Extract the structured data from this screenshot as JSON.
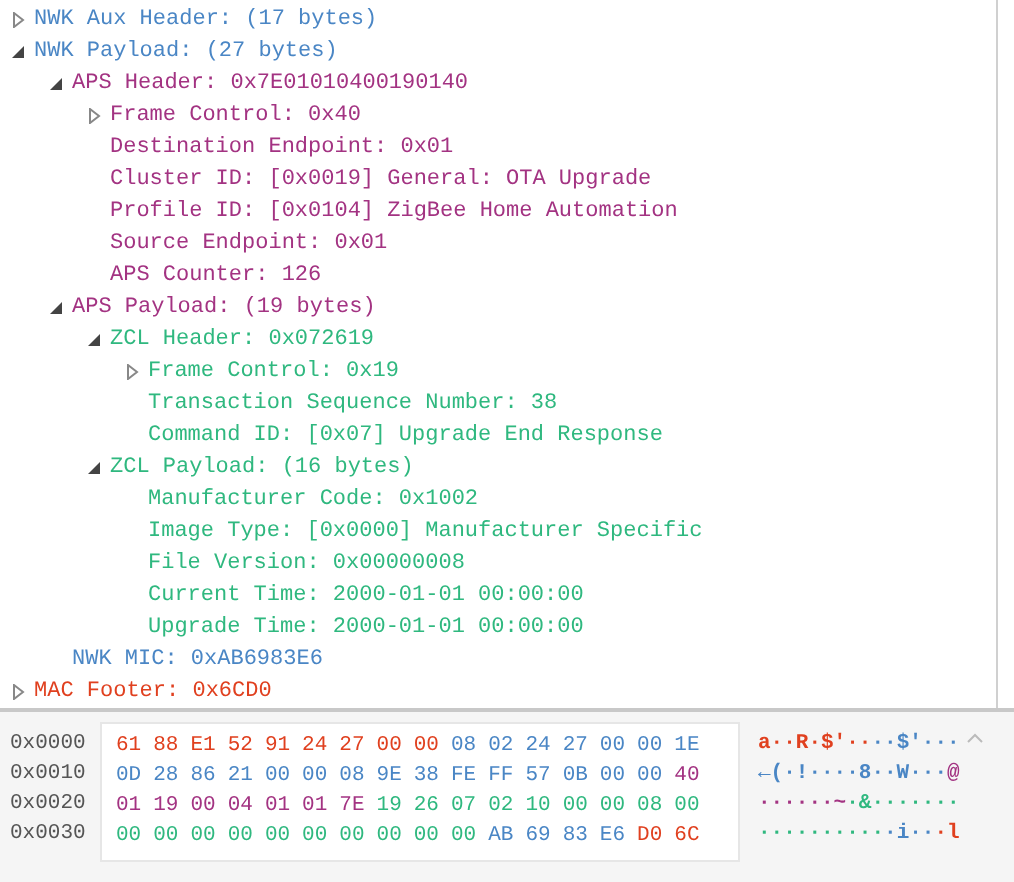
{
  "tree": [
    {
      "label": "NWK Aux Header: (17 bytes)",
      "color": "#4a86c5",
      "expanded": false
    },
    {
      "label": "NWK Payload: (27 bytes)",
      "color": "#4a86c5",
      "expanded": true,
      "children": [
        {
          "label": "APS Header: 0x7E01010400190140",
          "color": "#a33382",
          "expanded": true,
          "children": [
            {
              "label": "Frame Control: 0x40",
              "color": "#a33382",
              "expanded": false
            },
            {
              "label": "Destination Endpoint: 0x01",
              "color": "#a33382"
            },
            {
              "label": "Cluster ID: [0x0019] General: OTA Upgrade",
              "color": "#a33382"
            },
            {
              "label": "Profile ID: [0x0104] ZigBee Home Automation",
              "color": "#a33382"
            },
            {
              "label": "Source Endpoint: 0x01",
              "color": "#a33382"
            },
            {
              "label": "APS Counter: 126",
              "color": "#a33382"
            }
          ]
        },
        {
          "label": "APS Payload: (19 bytes)",
          "color": "#a33382",
          "expanded": true,
          "children": [
            {
              "label": "ZCL Header: 0x072619",
              "color": "#2fb87f",
              "expanded": true,
              "children": [
                {
                  "label": "Frame Control: 0x19",
                  "color": "#2fb87f",
                  "expanded": false
                },
                {
                  "label": "Transaction Sequence Number: 38",
                  "color": "#2fb87f"
                },
                {
                  "label": "Command ID: [0x07] Upgrade End Response",
                  "color": "#2fb87f"
                }
              ]
            },
            {
              "label": "ZCL Payload: (16 bytes)",
              "color": "#2fb87f",
              "expanded": true,
              "children": [
                {
                  "label": "Manufacturer Code: 0x1002",
                  "color": "#2fb87f"
                },
                {
                  "label": "Image Type: [0x0000] Manufacturer Specific",
                  "color": "#2fb87f"
                },
                {
                  "label": "File Version: 0x00000008",
                  "color": "#2fb87f"
                },
                {
                  "label": "Current Time: 2000-01-01 00:00:00",
                  "color": "#2fb87f"
                },
                {
                  "label": "Upgrade Time: 2000-01-01 00:00:00",
                  "color": "#2fb87f"
                }
              ]
            }
          ]
        },
        {
          "label": "NWK MIC: 0xAB6983E6",
          "color": "#4a86c5"
        }
      ]
    },
    {
      "label": "MAC Footer: 0x6CD0",
      "color": "#e0401f",
      "expanded": false
    }
  ],
  "hex_rows": [
    {
      "offset": "0x0000",
      "bytes": [
        {
          "text": "61",
          "color": "#e0401f"
        },
        {
          "text": "88",
          "color": "#e0401f"
        },
        {
          "text": "E1",
          "color": "#e0401f"
        },
        {
          "text": "52",
          "color": "#e0401f"
        },
        {
          "text": "91",
          "color": "#e0401f"
        },
        {
          "text": "24",
          "color": "#e0401f"
        },
        {
          "text": "27",
          "color": "#e0401f"
        },
        {
          "text": "00",
          "color": "#e0401f"
        },
        {
          "text": "00",
          "color": "#e0401f"
        },
        {
          "text": "08",
          "color": "#4a86c5"
        },
        {
          "text": "02",
          "color": "#4a86c5"
        },
        {
          "text": "24",
          "color": "#4a86c5"
        },
        {
          "text": "27",
          "color": "#4a86c5"
        },
        {
          "text": "00",
          "color": "#4a86c5"
        },
        {
          "text": "00",
          "color": "#4a86c5"
        },
        {
          "text": "1E",
          "color": "#4a86c5"
        }
      ],
      "ascii": [
        {
          "text": "a··R·$'··",
          "color": "#e0401f"
        },
        {
          "text": "··$'···",
          "color": "#4a86c5"
        }
      ]
    },
    {
      "offset": "0x0010",
      "bytes": [
        {
          "text": "0D",
          "color": "#4a86c5"
        },
        {
          "text": "28",
          "color": "#4a86c5"
        },
        {
          "text": "86",
          "color": "#4a86c5"
        },
        {
          "text": "21",
          "color": "#4a86c5"
        },
        {
          "text": "00",
          "color": "#4a86c5"
        },
        {
          "text": "00",
          "color": "#4a86c5"
        },
        {
          "text": "08",
          "color": "#4a86c5"
        },
        {
          "text": "9E",
          "color": "#4a86c5"
        },
        {
          "text": "38",
          "color": "#4a86c5"
        },
        {
          "text": "FE",
          "color": "#4a86c5"
        },
        {
          "text": "FF",
          "color": "#4a86c5"
        },
        {
          "text": "57",
          "color": "#4a86c5"
        },
        {
          "text": "0B",
          "color": "#4a86c5"
        },
        {
          "text": "00",
          "color": "#4a86c5"
        },
        {
          "text": "00",
          "color": "#4a86c5"
        },
        {
          "text": "40",
          "color": "#a33382"
        }
      ],
      "ascii": [
        {
          "text": "←(·!····8··W···",
          "color": "#4a86c5"
        },
        {
          "text": "@",
          "color": "#a33382"
        }
      ]
    },
    {
      "offset": "0x0020",
      "bytes": [
        {
          "text": "01",
          "color": "#a33382"
        },
        {
          "text": "19",
          "color": "#a33382"
        },
        {
          "text": "00",
          "color": "#a33382"
        },
        {
          "text": "04",
          "color": "#a33382"
        },
        {
          "text": "01",
          "color": "#a33382"
        },
        {
          "text": "01",
          "color": "#a33382"
        },
        {
          "text": "7E",
          "color": "#a33382"
        },
        {
          "text": "19",
          "color": "#2fb87f"
        },
        {
          "text": "26",
          "color": "#2fb87f"
        },
        {
          "text": "07",
          "color": "#2fb87f"
        },
        {
          "text": "02",
          "color": "#2fb87f"
        },
        {
          "text": "10",
          "color": "#2fb87f"
        },
        {
          "text": "00",
          "color": "#2fb87f"
        },
        {
          "text": "00",
          "color": "#2fb87f"
        },
        {
          "text": "08",
          "color": "#2fb87f"
        },
        {
          "text": "00",
          "color": "#2fb87f"
        }
      ],
      "ascii": [
        {
          "text": "······~",
          "color": "#a33382"
        },
        {
          "text": "·&·······",
          "color": "#2fb87f"
        }
      ]
    },
    {
      "offset": "0x0030",
      "bytes": [
        {
          "text": "00",
          "color": "#2fb87f"
        },
        {
          "text": "00",
          "color": "#2fb87f"
        },
        {
          "text": "00",
          "color": "#2fb87f"
        },
        {
          "text": "00",
          "color": "#2fb87f"
        },
        {
          "text": "00",
          "color": "#2fb87f"
        },
        {
          "text": "00",
          "color": "#2fb87f"
        },
        {
          "text": "00",
          "color": "#2fb87f"
        },
        {
          "text": "00",
          "color": "#2fb87f"
        },
        {
          "text": "00",
          "color": "#2fb87f"
        },
        {
          "text": "00",
          "color": "#2fb87f"
        },
        {
          "text": "AB",
          "color": "#4a86c5"
        },
        {
          "text": "69",
          "color": "#4a86c5"
        },
        {
          "text": "83",
          "color": "#4a86c5"
        },
        {
          "text": "E6",
          "color": "#4a86c5"
        },
        {
          "text": "D0",
          "color": "#e0401f"
        },
        {
          "text": "6C",
          "color": "#e0401f"
        }
      ],
      "ascii": [
        {
          "text": "··········",
          "color": "#2fb87f"
        },
        {
          "text": "·i··",
          "color": "#4a86c5"
        },
        {
          "text": "·l",
          "color": "#e0401f"
        }
      ]
    }
  ]
}
